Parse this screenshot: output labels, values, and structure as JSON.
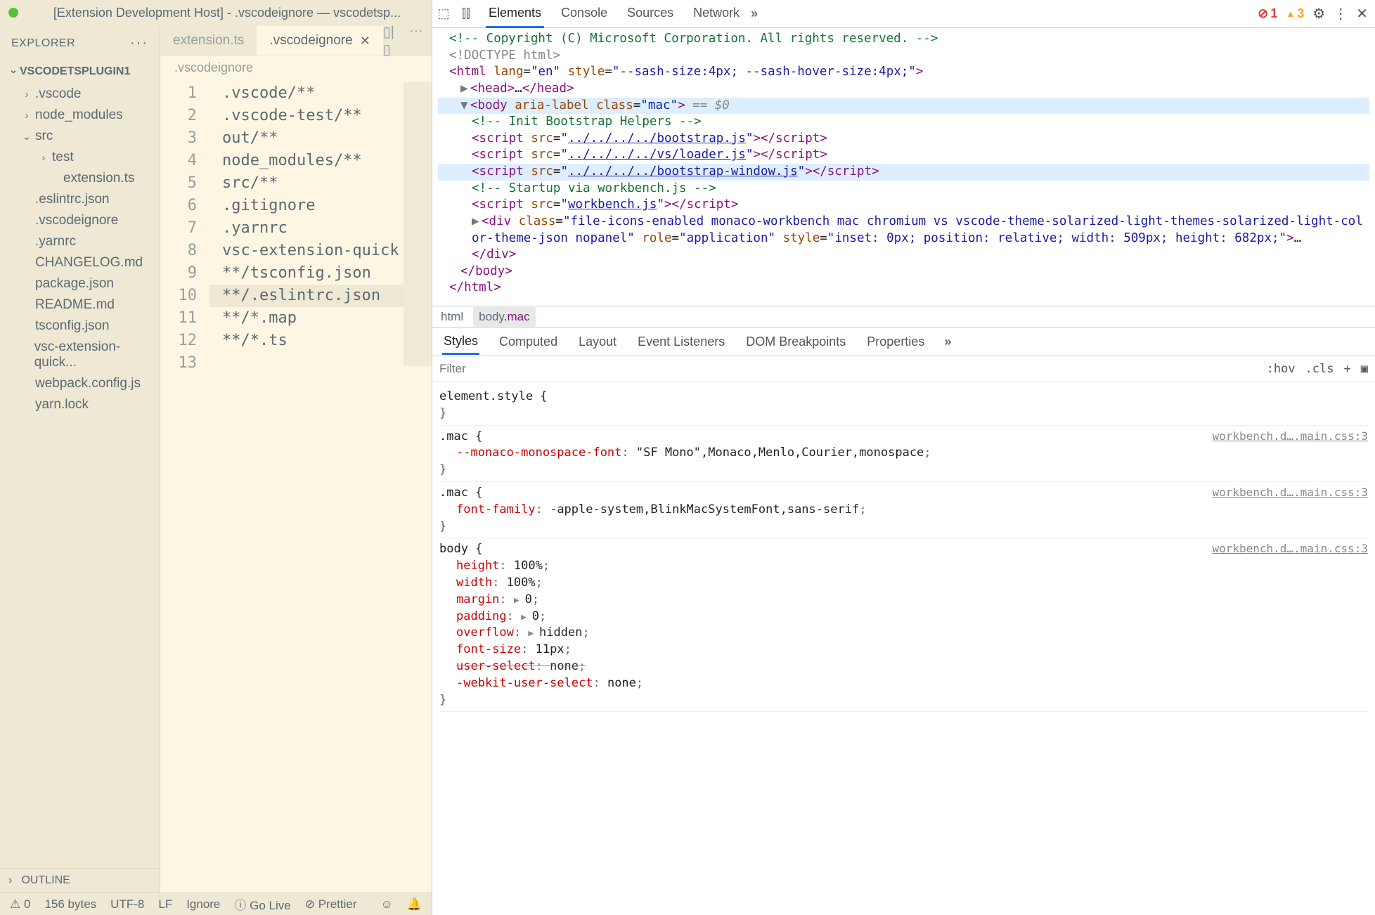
{
  "titlebar": "[Extension Development Host] - .vscodeignore — vscodetsp...",
  "sidebar": {
    "header": "EXPLORER",
    "project": "VSCODETSPLUGIN1",
    "outline": "OUTLINE",
    "items": [
      {
        "label": ".vscode",
        "kind": "folder",
        "indent": 1,
        "expand": "›"
      },
      {
        "label": "node_modules",
        "kind": "folder",
        "indent": 1,
        "expand": "›"
      },
      {
        "label": "src",
        "kind": "folder",
        "indent": 1,
        "expand": "⌄"
      },
      {
        "label": "test",
        "kind": "folder",
        "indent": 2,
        "expand": "›"
      },
      {
        "label": "extension.ts",
        "kind": "file",
        "indent": 3
      },
      {
        "label": ".eslintrc.json",
        "kind": "file",
        "indent": 1
      },
      {
        "label": ".vscodeignore",
        "kind": "file",
        "indent": 1
      },
      {
        "label": ".yarnrc",
        "kind": "file",
        "indent": 1
      },
      {
        "label": "CHANGELOG.md",
        "kind": "file",
        "indent": 1
      },
      {
        "label": "package.json",
        "kind": "file",
        "indent": 1
      },
      {
        "label": "README.md",
        "kind": "file",
        "indent": 1
      },
      {
        "label": "tsconfig.json",
        "kind": "file",
        "indent": 1
      },
      {
        "label": "vsc-extension-quick...",
        "kind": "file",
        "indent": 1
      },
      {
        "label": "webpack.config.js",
        "kind": "file",
        "indent": 1
      },
      {
        "label": "yarn.lock",
        "kind": "file",
        "indent": 1
      }
    ]
  },
  "tabs": [
    {
      "label": "extension.ts",
      "active": false
    },
    {
      "label": ".vscodeignore",
      "active": true
    }
  ],
  "breadcrumb": ".vscodeignore",
  "editor": {
    "filename": ".vscodeignore",
    "highlight_line": 10,
    "lines": [
      ".vscode/**",
      ".vscode-test/**",
      "out/**",
      "node_modules/**",
      "src/**",
      ".gitignore",
      ".yarnrc",
      "vsc-extension-quick",
      "**/tsconfig.json",
      "**/.eslintrc.json",
      "**/*.map",
      "**/*.ts",
      ""
    ]
  },
  "statusbar": {
    "problems": "0",
    "size": "156 bytes",
    "encoding": "UTF-8",
    "eol": "LF",
    "lang": "Ignore",
    "golive": "Go Live",
    "prettier": "Prettier"
  },
  "devtools": {
    "tabs": [
      "Elements",
      "Console",
      "Sources",
      "Network"
    ],
    "active_tab": "Elements",
    "more": "»",
    "errors": "1",
    "warnings": "3",
    "dom_comment": "<!-- Copyright (C) Microsoft Corporation. All rights reserved. -->",
    "doctype": "<!DOCTYPE html>",
    "html_open": {
      "lang": "en",
      "style": "--sash-size:4px; --sash-hover-size:4px;"
    },
    "body_open": {
      "class": "mac",
      "eq": "== $0"
    },
    "init_comment": "<!-- Init Bootstrap Helpers -->",
    "scripts": [
      "../../../../bootstrap.js",
      "../../../../vs/loader.js",
      "../../../../bootstrap-window.js"
    ],
    "startup_comment": "<!-- Startup via workbench.js -->",
    "workbench_script": "workbench.js",
    "div_class": "file-icons-enabled monaco-workbench mac chromium vs vscode-theme-solarized-light-themes-solarized-light-color-theme-json nopanel",
    "div_role": "application",
    "div_style": "inset: 0px; position: relative; width: 509px; height: 682px;",
    "breadcrumbs": [
      "html",
      "body.mac"
    ],
    "style_tabs": [
      "Styles",
      "Computed",
      "Layout",
      "Event Listeners",
      "DOM Breakpoints",
      "Properties"
    ],
    "active_style_tab": "Styles",
    "filter_placeholder": "Filter",
    "filter_ctrls": [
      ":hov",
      ".cls",
      "+"
    ],
    "rules": [
      {
        "selector": "element.style",
        "props": []
      },
      {
        "selector": ".mac",
        "src": "workbench.d….main.css:3",
        "props": [
          {
            "name": "--monaco-monospace-font",
            "val": "\"SF Mono\",Monaco,Menlo,Courier,monospace"
          }
        ]
      },
      {
        "selector": ".mac",
        "src": "workbench.d….main.css:3",
        "props": [
          {
            "name": "font-family",
            "val": "-apple-system,BlinkMacSystemFont,sans-serif"
          }
        ]
      },
      {
        "selector": "body",
        "src": "workbench.d….main.css:3",
        "props": [
          {
            "name": "height",
            "val": "100%"
          },
          {
            "name": "width",
            "val": "100%"
          },
          {
            "name": "margin",
            "val": "0",
            "tri": true
          },
          {
            "name": "padding",
            "val": "0",
            "tri": true
          },
          {
            "name": "overflow",
            "val": "hidden",
            "tri": true
          },
          {
            "name": "font-size",
            "val": "11px"
          },
          {
            "name": "user-select",
            "val": "none",
            "struck": true
          },
          {
            "name": "-webkit-user-select",
            "val": "none"
          }
        ]
      }
    ]
  }
}
